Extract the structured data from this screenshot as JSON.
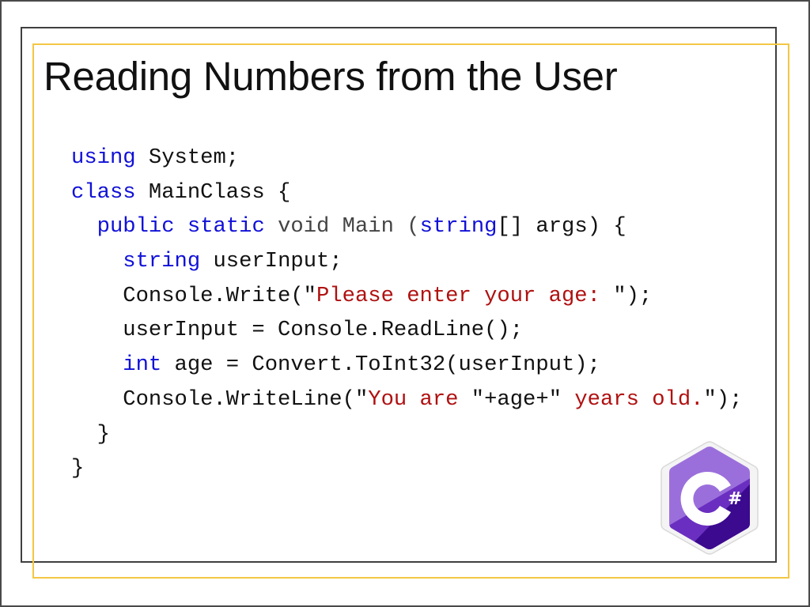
{
  "slide": {
    "title": "Reading Numbers from the User",
    "colors": {
      "keyword": "#1010d8",
      "string": "#b01010",
      "dim": "#444444",
      "text": "#111111",
      "gold_frame": "#f3c744",
      "dark_frame": "#3f3f3f"
    },
    "code_lines": [
      {
        "indent": "",
        "tokens": [
          {
            "t": "using",
            "c": "kw"
          },
          {
            "t": " System;",
            "c": "plain"
          }
        ]
      },
      {
        "indent": "",
        "tokens": [
          {
            "t": "class",
            "c": "kw"
          },
          {
            "t": " MainClass {",
            "c": "plain"
          }
        ]
      },
      {
        "indent": "  ",
        "tokens": [
          {
            "t": "public",
            "c": "kw"
          },
          {
            "t": " ",
            "c": "plain"
          },
          {
            "t": "static",
            "c": "kw"
          },
          {
            "t": " void Main (",
            "c": "dim"
          },
          {
            "t": "string",
            "c": "kw"
          },
          {
            "t": "[] args) {",
            "c": "plain"
          }
        ]
      },
      {
        "indent": "    ",
        "tokens": [
          {
            "t": "string",
            "c": "kw"
          },
          {
            "t": " userInput;",
            "c": "plain"
          }
        ]
      },
      {
        "indent": "    ",
        "tokens": [
          {
            "t": "Console.Write(\"",
            "c": "plain"
          },
          {
            "t": "Please enter your age: ",
            "c": "str"
          },
          {
            "t": "\");",
            "c": "plain"
          }
        ]
      },
      {
        "indent": "    ",
        "tokens": [
          {
            "t": "userInput = Console.ReadLine();",
            "c": "plain"
          }
        ]
      },
      {
        "indent": "    ",
        "tokens": [
          {
            "t": "int",
            "c": "kw"
          },
          {
            "t": " age = Convert.ToInt32(userInput);",
            "c": "plain"
          }
        ]
      },
      {
        "indent": "    ",
        "tokens": [
          {
            "t": "Console.WriteLine(\"",
            "c": "plain"
          },
          {
            "t": "You are ",
            "c": "str"
          },
          {
            "t": "\"+age+\" ",
            "c": "plain"
          },
          {
            "t": "years old.",
            "c": "str"
          },
          {
            "t": "\");",
            "c": "plain"
          }
        ]
      },
      {
        "indent": "  ",
        "tokens": [
          {
            "t": "}",
            "c": "plain"
          }
        ]
      },
      {
        "indent": "",
        "tokens": [
          {
            "t": "}",
            "c": "plain"
          }
        ]
      }
    ],
    "logo": {
      "icon": "csharp-logo-icon",
      "label": "C#",
      "colors": {
        "light": "#9b6fdb",
        "mid": "#6a2fc0",
        "dark": "#3b0a8f",
        "border": "#e6e6e6"
      }
    }
  }
}
